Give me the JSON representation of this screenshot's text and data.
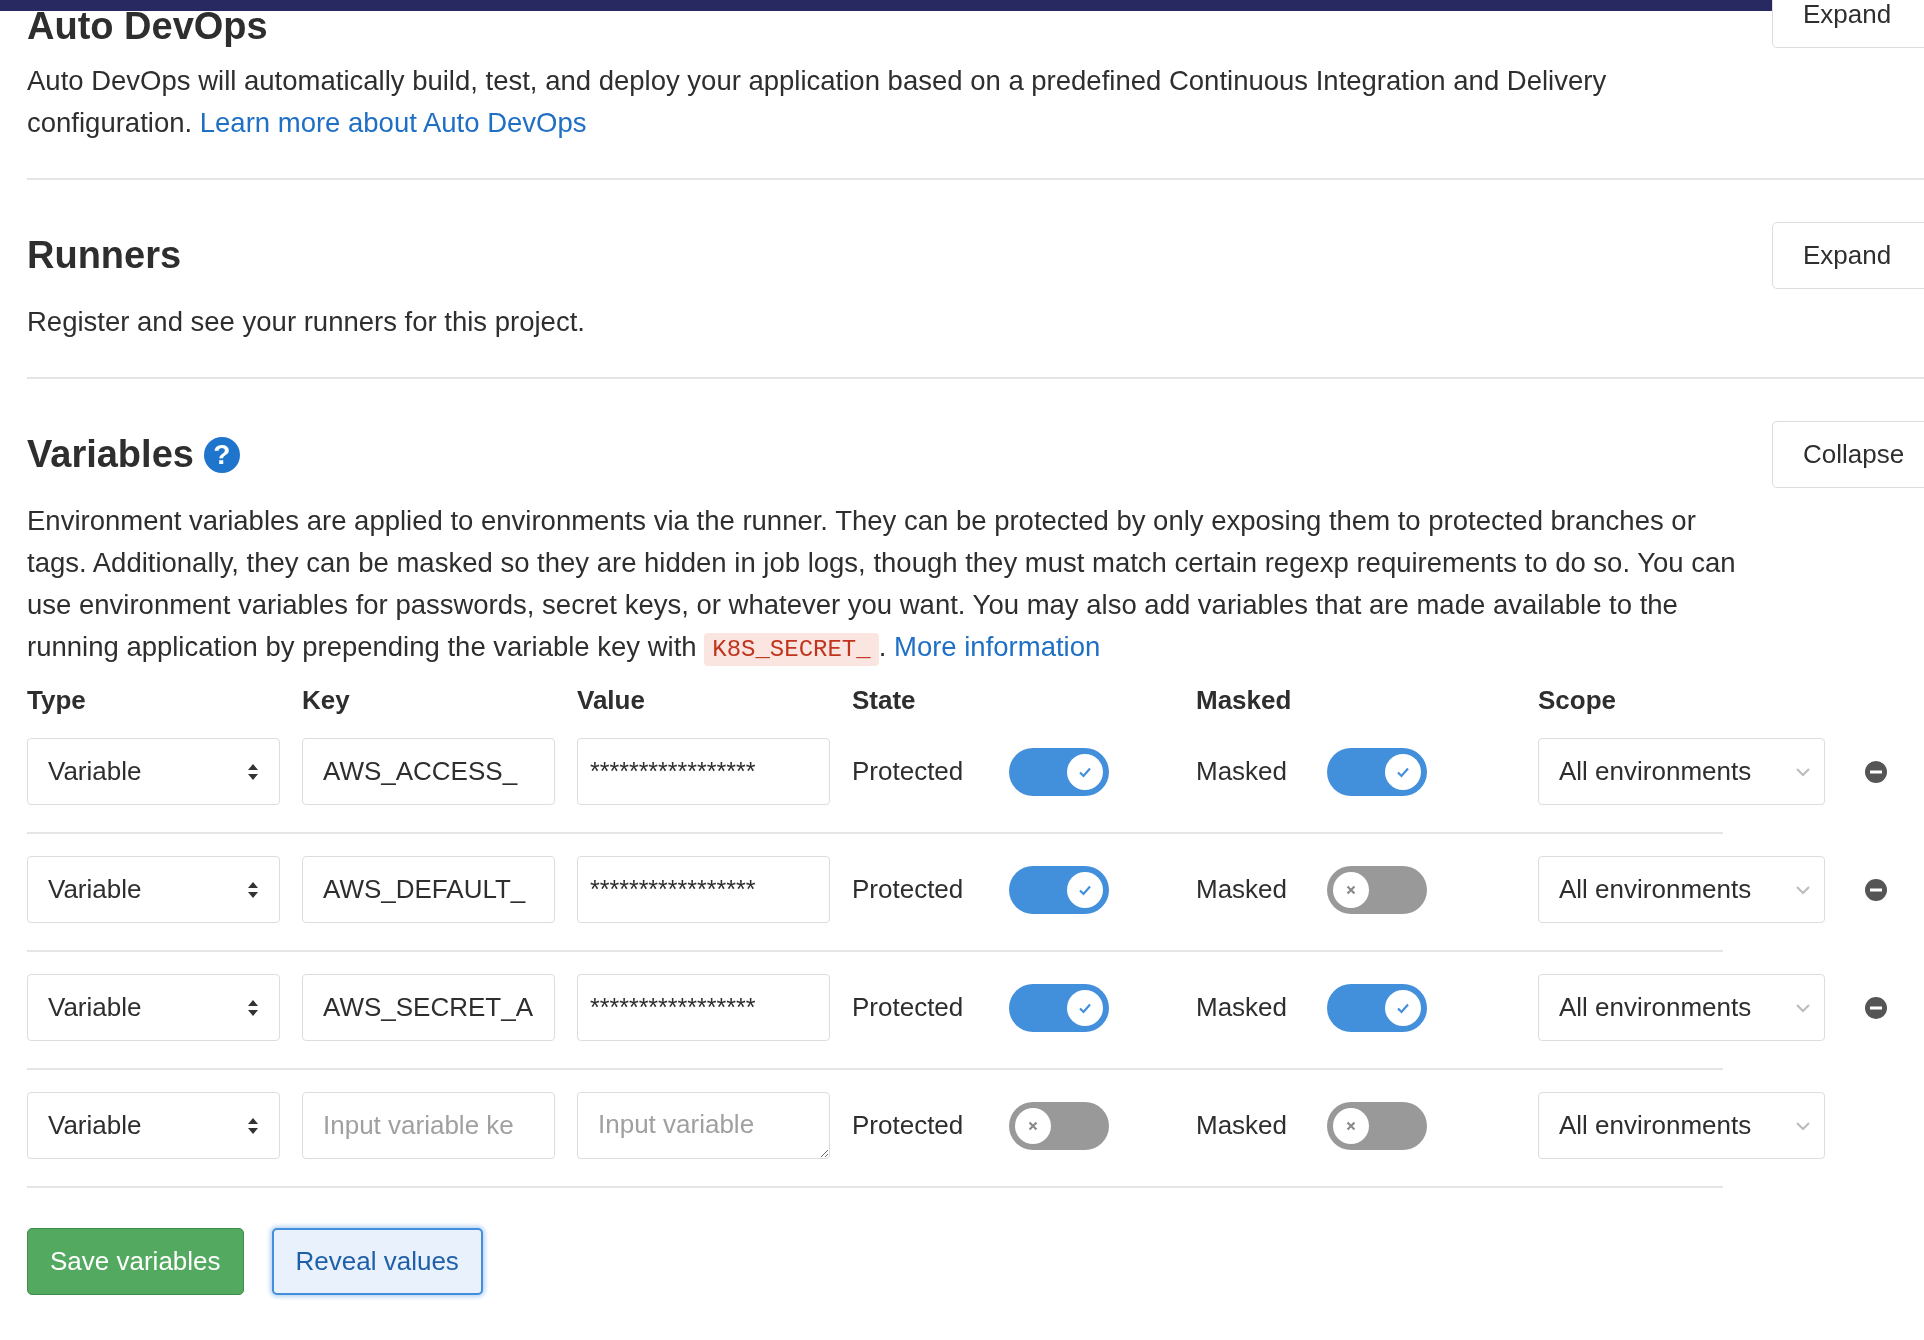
{
  "sections": [
    {
      "title": "Auto DevOps",
      "description": "Auto DevOps will automatically build, test, and deploy your application based on a predefined Continuous Integration and Delivery configuration.",
      "link": "Learn more about Auto DevOps",
      "button": "Expand"
    },
    {
      "title": "Runners",
      "description": "Register and see your runners for this project.",
      "button": "Expand"
    }
  ],
  "variables": {
    "title": "Variables",
    "help": "?",
    "button": "Collapse",
    "description": "Environment variables are applied to environments via the runner. They can be protected by only exposing them to protected branches or tags. Additionally, they can be masked so they are hidden in job logs, though they must match certain regexp requirements to do so. You can use environment variables for passwords, secret keys, or whatever you want. You may also add variables that are made available to the running application by prepending the variable key with",
    "code": "K8S_SECRET_",
    "after_code": ".",
    "link": "More information",
    "columns": [
      "Type",
      "Key",
      "Value",
      "State",
      "Masked",
      "Scope"
    ],
    "rows": [
      {
        "type": "Variable",
        "key": "AWS_ACCESS_",
        "value": "*****************",
        "protected_label": "Protected",
        "protected": true,
        "masked_label": "Masked",
        "masked": true,
        "scope": "All environments",
        "removable": true
      },
      {
        "type": "Variable",
        "key": "AWS_DEFAULT_",
        "value": "*****************",
        "protected_label": "Protected",
        "protected": true,
        "masked_label": "Masked",
        "masked": false,
        "scope": "All environments",
        "removable": true
      },
      {
        "type": "Variable",
        "key": "AWS_SECRET_A",
        "value": "*****************",
        "protected_label": "Protected",
        "protected": true,
        "masked_label": "Masked",
        "masked": true,
        "scope": "All environments",
        "removable": true
      },
      {
        "type": "Variable",
        "key_placeholder": "Input variable ke",
        "value_placeholder": "Input variable",
        "protected_label": "Protected",
        "protected": false,
        "masked_label": "Masked",
        "masked": false,
        "scope": "All environments",
        "removable": false
      }
    ],
    "save_button": "Save variables",
    "reveal_button": "Reveal values"
  }
}
